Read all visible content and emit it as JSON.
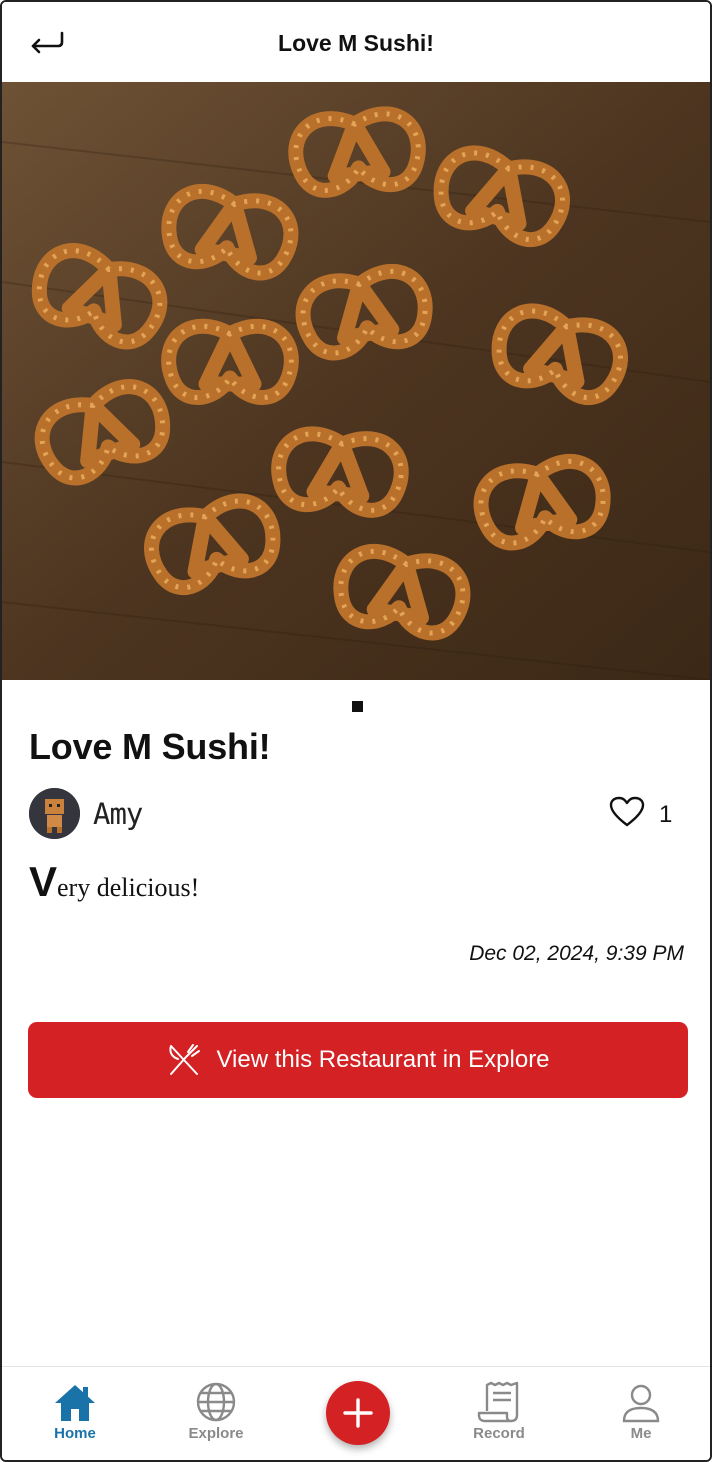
{
  "header": {
    "title": "Love M Sushi!"
  },
  "post": {
    "title": "Love M Sushi!",
    "author": "Amy",
    "like_count": "1",
    "body_first_letter": "V",
    "body_rest": "ery delicious!",
    "timestamp": "Dec 02, 2024, 9:39 PM",
    "photo_count": 1,
    "current_photo": 1
  },
  "action": {
    "explore_label": "View this Restaurant in Explore"
  },
  "nav": {
    "items": [
      {
        "label": "Home",
        "icon": "home-icon",
        "active": true
      },
      {
        "label": "Explore",
        "icon": "globe-icon",
        "active": false
      },
      {
        "label": "",
        "icon": "plus-icon",
        "active": false
      },
      {
        "label": "Record",
        "icon": "receipt-icon",
        "active": false
      },
      {
        "label": "Me",
        "icon": "person-icon",
        "active": false
      }
    ]
  },
  "colors": {
    "accent_red": "#d42124",
    "active_blue": "#1a73a8",
    "inactive_gray": "#8a8a8a"
  }
}
